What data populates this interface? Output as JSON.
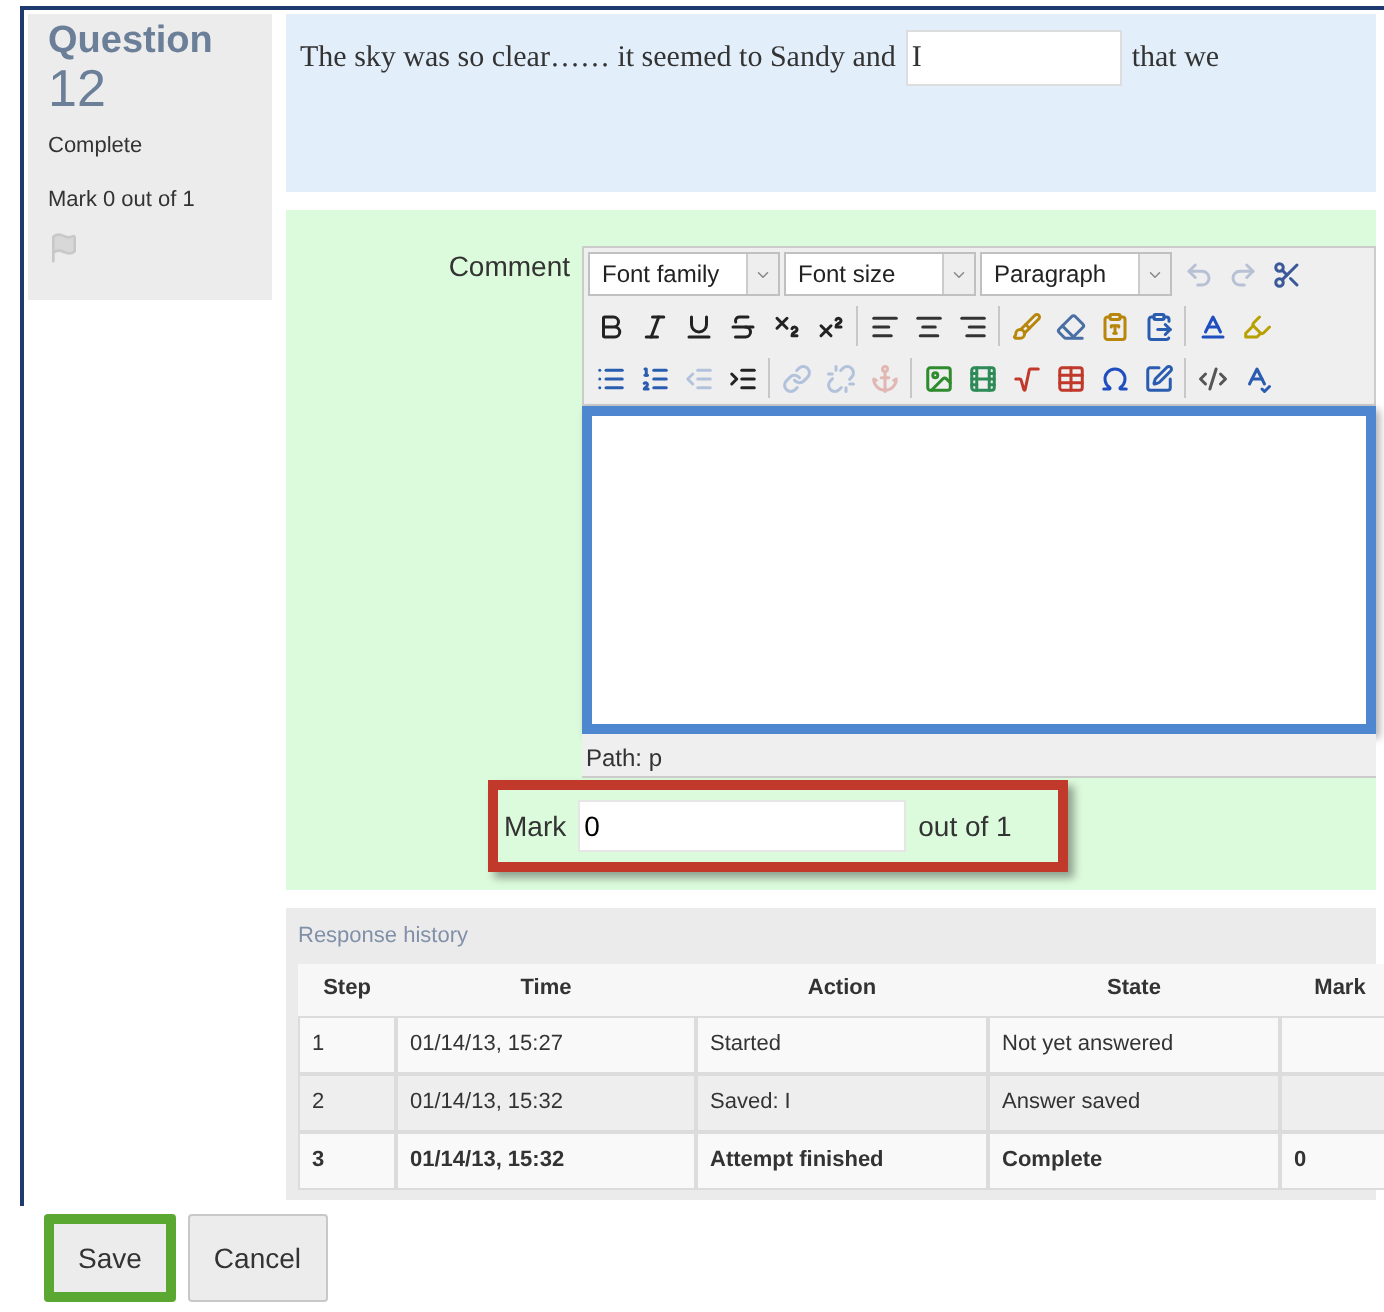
{
  "question": {
    "label": "Question",
    "number": "12",
    "status": "Complete",
    "mark": "Mark 0 out of 1",
    "flagged": false
  },
  "prompt": {
    "before": "The sky was so clear…… it seemed to Sandy and",
    "answer": "I",
    "after": "that we"
  },
  "comment": {
    "label": "Comment",
    "toolbar": [
      [
        {
          "kind": "select",
          "value": "Font family"
        },
        {
          "kind": "select",
          "value": "Font size"
        },
        {
          "kind": "select",
          "value": "Paragraph"
        },
        {
          "kind": "undo",
          "disabled": true
        },
        {
          "kind": "redo",
          "disabled": true
        },
        {
          "kind": "cut",
          "disabled": false
        }
      ],
      [
        {
          "kind": "bold",
          "disabled": false
        },
        {
          "kind": "italic",
          "disabled": false
        },
        {
          "kind": "underline",
          "disabled": false
        },
        {
          "kind": "strike",
          "disabled": false
        },
        {
          "kind": "sub",
          "disabled": false
        },
        {
          "kind": "sup",
          "disabled": false
        },
        {
          "kind": "sep"
        },
        {
          "kind": "alignleft",
          "disabled": false
        },
        {
          "kind": "aligncenter",
          "disabled": false
        },
        {
          "kind": "alignright",
          "disabled": false
        },
        {
          "kind": "sep"
        },
        {
          "kind": "brush",
          "disabled": false
        },
        {
          "kind": "eraser",
          "disabled": false
        },
        {
          "kind": "pastetext",
          "disabled": false
        },
        {
          "kind": "pasteword",
          "disabled": false
        },
        {
          "kind": "sep"
        },
        {
          "kind": "textcolor",
          "disabled": false
        },
        {
          "kind": "highlight",
          "disabled": false
        }
      ],
      [
        {
          "kind": "bullets",
          "disabled": false
        },
        {
          "kind": "numbers",
          "disabled": false
        },
        {
          "kind": "outdent",
          "disabled": true
        },
        {
          "kind": "indent",
          "disabled": false
        },
        {
          "kind": "sep"
        },
        {
          "kind": "link",
          "disabled": true
        },
        {
          "kind": "unlink",
          "disabled": true
        },
        {
          "kind": "anchor",
          "disabled": true
        },
        {
          "kind": "sep"
        },
        {
          "kind": "image",
          "disabled": false
        },
        {
          "kind": "media",
          "disabled": false
        },
        {
          "kind": "equation",
          "disabled": false
        },
        {
          "kind": "table",
          "disabled": false
        },
        {
          "kind": "omega",
          "disabled": false
        },
        {
          "kind": "edit",
          "disabled": false
        },
        {
          "kind": "sep"
        },
        {
          "kind": "html",
          "disabled": false
        },
        {
          "kind": "spell",
          "disabled": false
        }
      ]
    ],
    "path": "Path: p"
  },
  "mark": {
    "label": "Mark",
    "value": "0",
    "suffix": "out of 1"
  },
  "history": {
    "title": "Response history",
    "columns": [
      "Step",
      "Time",
      "Action",
      "State",
      "Mark"
    ],
    "rows": [
      {
        "cells": [
          "1",
          "01/14/13, 15:27",
          "Started",
          "Not yet answered",
          ""
        ],
        "current": false
      },
      {
        "cells": [
          "2",
          "01/14/13, 15:32",
          "Saved: I",
          "Answer saved",
          ""
        ],
        "current": false
      },
      {
        "cells": [
          "3",
          "01/14/13, 15:32",
          "Attempt finished",
          "Complete",
          "0"
        ],
        "current": true
      }
    ]
  },
  "buttons": [
    {
      "label": "Save",
      "highlighted": true
    },
    {
      "label": "Cancel",
      "highlighted": false
    }
  ]
}
